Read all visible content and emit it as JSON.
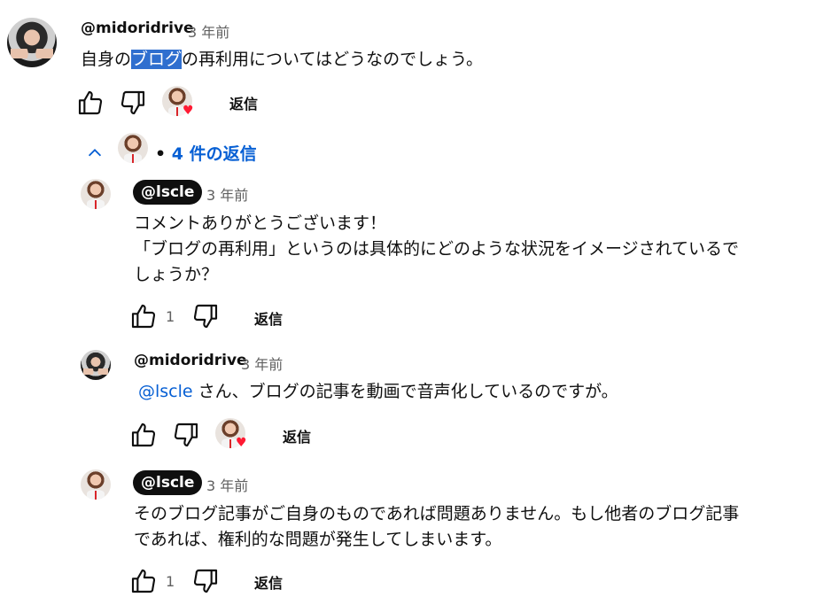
{
  "top_comment": {
    "author": "@midoridrive",
    "time": "3 年前",
    "text_before": "自身の",
    "text_highlight": "ブログ",
    "text_after": "の再利用についてはどうなのでしょう。",
    "reply_label": "返信"
  },
  "replies_toggle": {
    "separator": "•",
    "label": "4 件の返信"
  },
  "replies": [
    {
      "author": "@lscle",
      "time": "3 年前",
      "lines": [
        "コメントありがとうございます！",
        "「ブログの再利用」というのは具体的にどのような状況をイメージされているで",
        "しょうか？"
      ],
      "like_count": "1",
      "reply_label": "返信"
    },
    {
      "author": "@midoridrive",
      "time": "3 年前",
      "mention": "@lscle",
      "text": " さん、ブログの記事を動画で音声化しているのですが。",
      "reply_label": "返信"
    },
    {
      "author": "@lscle",
      "time": "3 年前",
      "lines": [
        "そのブログ記事がご自身のものであれば問題ありません。もし他者のブログ記事",
        "であれば、権利的な問題が発生してしまいます。"
      ],
      "like_count": "1",
      "reply_label": "返信"
    }
  ],
  "icons": {
    "like": "thumb-up-icon",
    "dislike": "thumb-down-icon",
    "collapse": "chevron-up-icon",
    "creator_heart": "heart-icon"
  },
  "colors": {
    "link_blue": "#065fd4",
    "highlight": "#2f6fcf",
    "heart_red": "#ff1a33",
    "creator_pill_bg": "#0f0f0f"
  }
}
